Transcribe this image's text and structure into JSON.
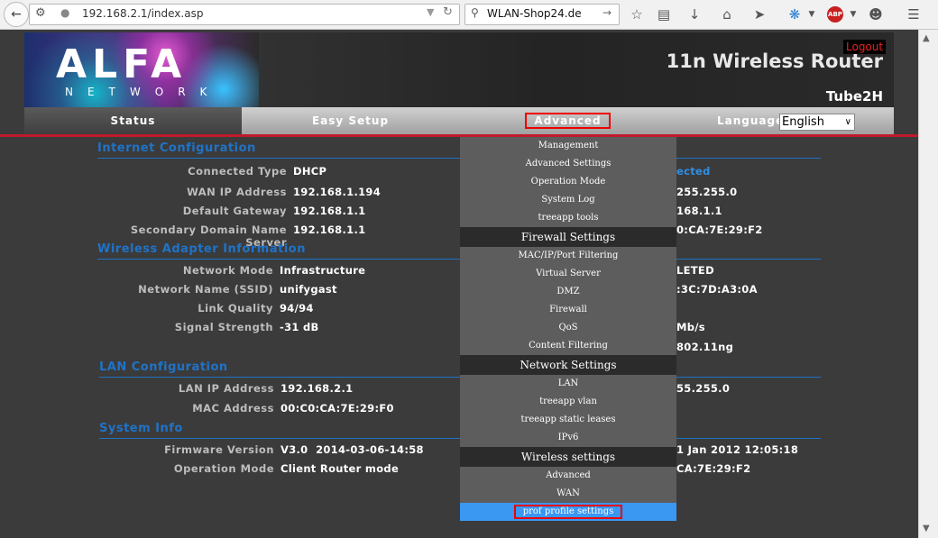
{
  "browser": {
    "url": "192.168.2.1/index.asp",
    "search": "WLAN-Shop24.de",
    "icons": [
      "back-arrow-icon",
      "site-info-icon",
      "reload-icon",
      "star-icon",
      "reading-list-icon",
      "download-icon",
      "home-icon",
      "send-icon",
      "addon-icon",
      "adblock-icon",
      "chat-icon",
      "menu-icon"
    ],
    "adblock_label": "ABP"
  },
  "header": {
    "logo": "ALFA",
    "logo_sub": "NETWORK",
    "logout": "Logout",
    "product_title": "11n Wireless Router",
    "model": "Tube2H"
  },
  "nav": {
    "tabs": [
      "Status",
      "Easy Setup",
      "Advanced",
      "Language"
    ],
    "language_value": "English"
  },
  "internet": {
    "title": "Internet Configuration",
    "rows": [
      {
        "label": "Connected Type",
        "value": "DHCP"
      },
      {
        "label": "WAN IP Address",
        "value": "192.168.1.194"
      },
      {
        "label": "Default Gateway",
        "value": "192.168.1.1"
      },
      {
        "label": "Secondary Domain Name Server",
        "value": "192.168.1.1"
      }
    ],
    "right_values": [
      "ected",
      "255.255.0",
      "168.1.1",
      "0:CA:7E:29:F2"
    ]
  },
  "wireless": {
    "title": "Wireless Adapter Information",
    "rows": [
      {
        "label": "Network Mode",
        "value": "Infrastructure"
      },
      {
        "label": "Network Name (SSID)",
        "value": "unifygast"
      },
      {
        "label": "Link Quality",
        "value": "94/94"
      },
      {
        "label": "Signal Strength",
        "value": "-31 dB"
      }
    ],
    "right_values": [
      "LETED",
      ":3C:7D:A3:0A",
      "",
      "Mb/s",
      "802.11ng"
    ]
  },
  "lan": {
    "title": "LAN Configuration",
    "rows": [
      {
        "label": "LAN IP Address",
        "value": "192.168.2.1"
      },
      {
        "label": "MAC Address",
        "value": "00:C0:CA:7E:29:F0"
      }
    ],
    "right_values": [
      "55.255.0"
    ]
  },
  "system": {
    "title": "System Info",
    "rows": [
      {
        "label": "Firmware Version",
        "value": "V3.0  2014-03-06-14:58"
      },
      {
        "label": "Operation Mode",
        "value": "Client Router mode"
      }
    ],
    "right_values": [
      "1 Jan 2012 12:05:18",
      "CA:7E:29:F2"
    ]
  },
  "menu": {
    "management": [
      "Management",
      "Advanced Settings",
      "Operation Mode",
      "System Log",
      "treeapp tools"
    ],
    "firewall_head": "Firewall Settings",
    "firewall": [
      "MAC/IP/Port Filtering",
      "Virtual Server",
      "DMZ",
      "Firewall",
      "QoS",
      "Content Filtering"
    ],
    "network_head": "Network Settings",
    "network": [
      "LAN",
      "treeapp vlan",
      "treeapp static leases",
      "IPv6"
    ],
    "wireless_head": "Wireless settings",
    "wireless": [
      "Advanced",
      "WAN",
      "prof profile settings"
    ]
  },
  "colors": {
    "section_blue": "#1f73c8",
    "accent_red": "#c01a2a",
    "menu_highlight": "#3a97f2",
    "page_bg": "#3b3b3b"
  }
}
